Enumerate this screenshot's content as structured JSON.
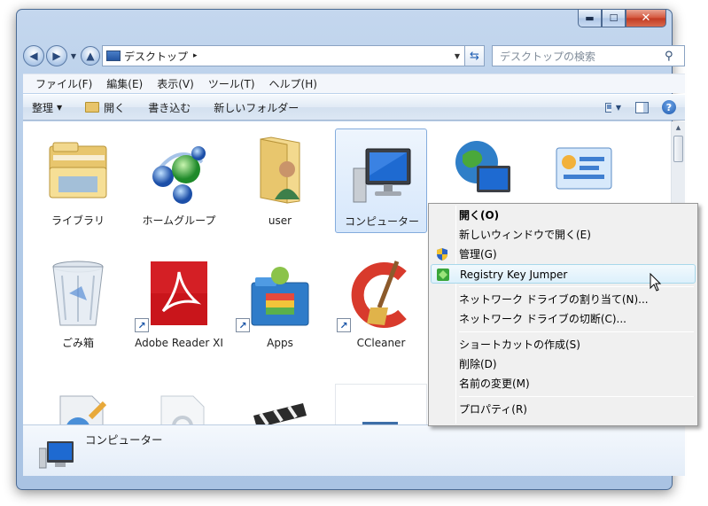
{
  "window": {
    "buttons": {
      "minimize": "▬",
      "maximize": "☐",
      "close": "✕"
    }
  },
  "nav": {
    "back_icon": "back-arrow-icon",
    "forward_icon": "forward-arrow-icon",
    "address": "デスクトップ",
    "address_separator": "▸",
    "search_placeholder": "デスクトップの検索"
  },
  "menubar": {
    "items": [
      "ファイル(F)",
      "編集(E)",
      "表示(V)",
      "ツール(T)",
      "ヘルプ(H)"
    ]
  },
  "toolbar": {
    "organize": "整理",
    "open": "開く",
    "burn": "書き込む",
    "new_folder": "新しいフォルダー",
    "help": "?"
  },
  "items": [
    {
      "label": "ライブラリ",
      "icon": "library-icon",
      "shortcut": false,
      "selected": false
    },
    {
      "label": "ホームグループ",
      "icon": "homegroup-icon",
      "shortcut": false,
      "selected": false
    },
    {
      "label": "user",
      "icon": "user-folder-icon",
      "shortcut": false,
      "selected": false
    },
    {
      "label": "コンピューター",
      "icon": "computer-icon",
      "shortcut": false,
      "selected": true
    },
    {
      "label": "",
      "icon": "network-icon",
      "shortcut": false,
      "selected": false
    },
    {
      "label": "",
      "icon": "control-panel-icon",
      "shortcut": false,
      "selected": false
    },
    {
      "label": "ごみ箱",
      "icon": "recycle-bin-icon",
      "shortcut": false,
      "selected": false
    },
    {
      "label": "Adobe Reader XI",
      "icon": "adobe-reader-icon",
      "shortcut": true,
      "selected": false
    },
    {
      "label": "Apps",
      "icon": "apps-folder-icon",
      "shortcut": true,
      "selected": false
    },
    {
      "label": "CCleaner",
      "icon": "ccleaner-icon",
      "shortcut": true,
      "selected": false
    }
  ],
  "details": {
    "name": "コンピューター"
  },
  "context_menu": {
    "open": "開く(O)",
    "open_new_window": "新しいウィンドウで開く(E)",
    "manage": "管理(G)",
    "registry_key_jumper": "Registry Key Jumper",
    "map_network_drive": "ネットワーク ドライブの割り当て(N)...",
    "disconnect_network_drive": "ネットワーク ドライブの切断(C)...",
    "create_shortcut": "ショートカットの作成(S)",
    "delete": "削除(D)",
    "rename": "名前の変更(M)",
    "properties": "プロパティ(R)"
  },
  "colors": {
    "frame": "#b3cbe8",
    "selection": "#d6e7fb",
    "menu_hover": "#dcf0fb",
    "close_button": "#c23a22"
  }
}
